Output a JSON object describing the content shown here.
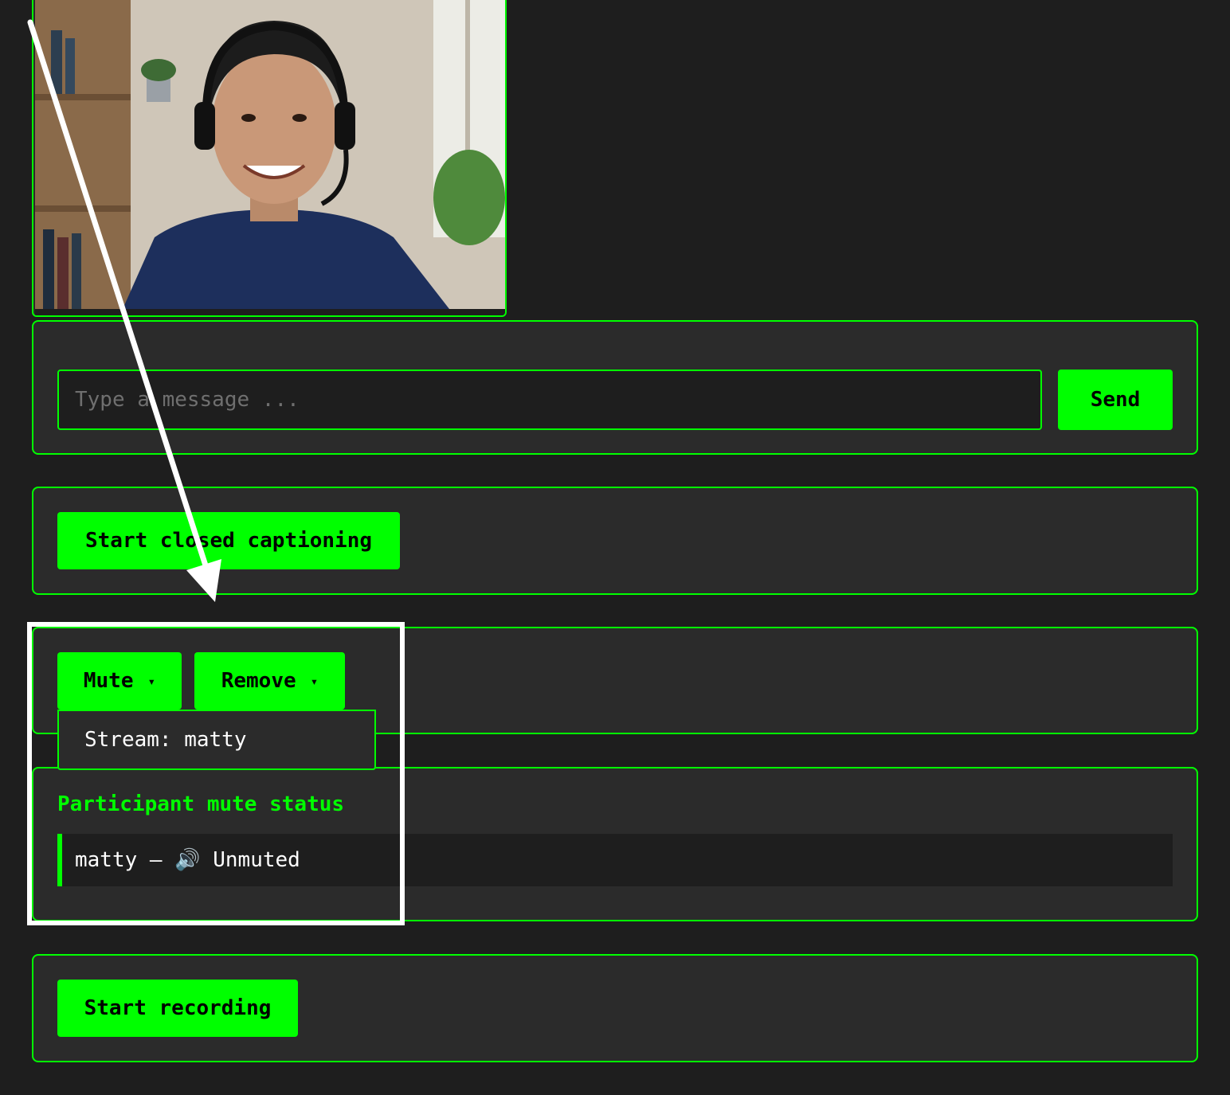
{
  "chat": {
    "placeholder": "Type a message ...",
    "send_label": "Send"
  },
  "captions": {
    "button_label": "Start closed captioning"
  },
  "controls": {
    "mute_label": "Mute",
    "remove_label": "Remove",
    "caret": "▾",
    "dropdown_item": "Stream: matty"
  },
  "mute_status": {
    "title": "Participant mute status",
    "entries": [
      {
        "text": "matty — 🔊 Unmuted"
      }
    ]
  },
  "recording": {
    "button_label": "Start recording"
  },
  "colors": {
    "accent": "#00ff00",
    "background": "#1e1e1e",
    "panel": "#2b2b2b"
  }
}
